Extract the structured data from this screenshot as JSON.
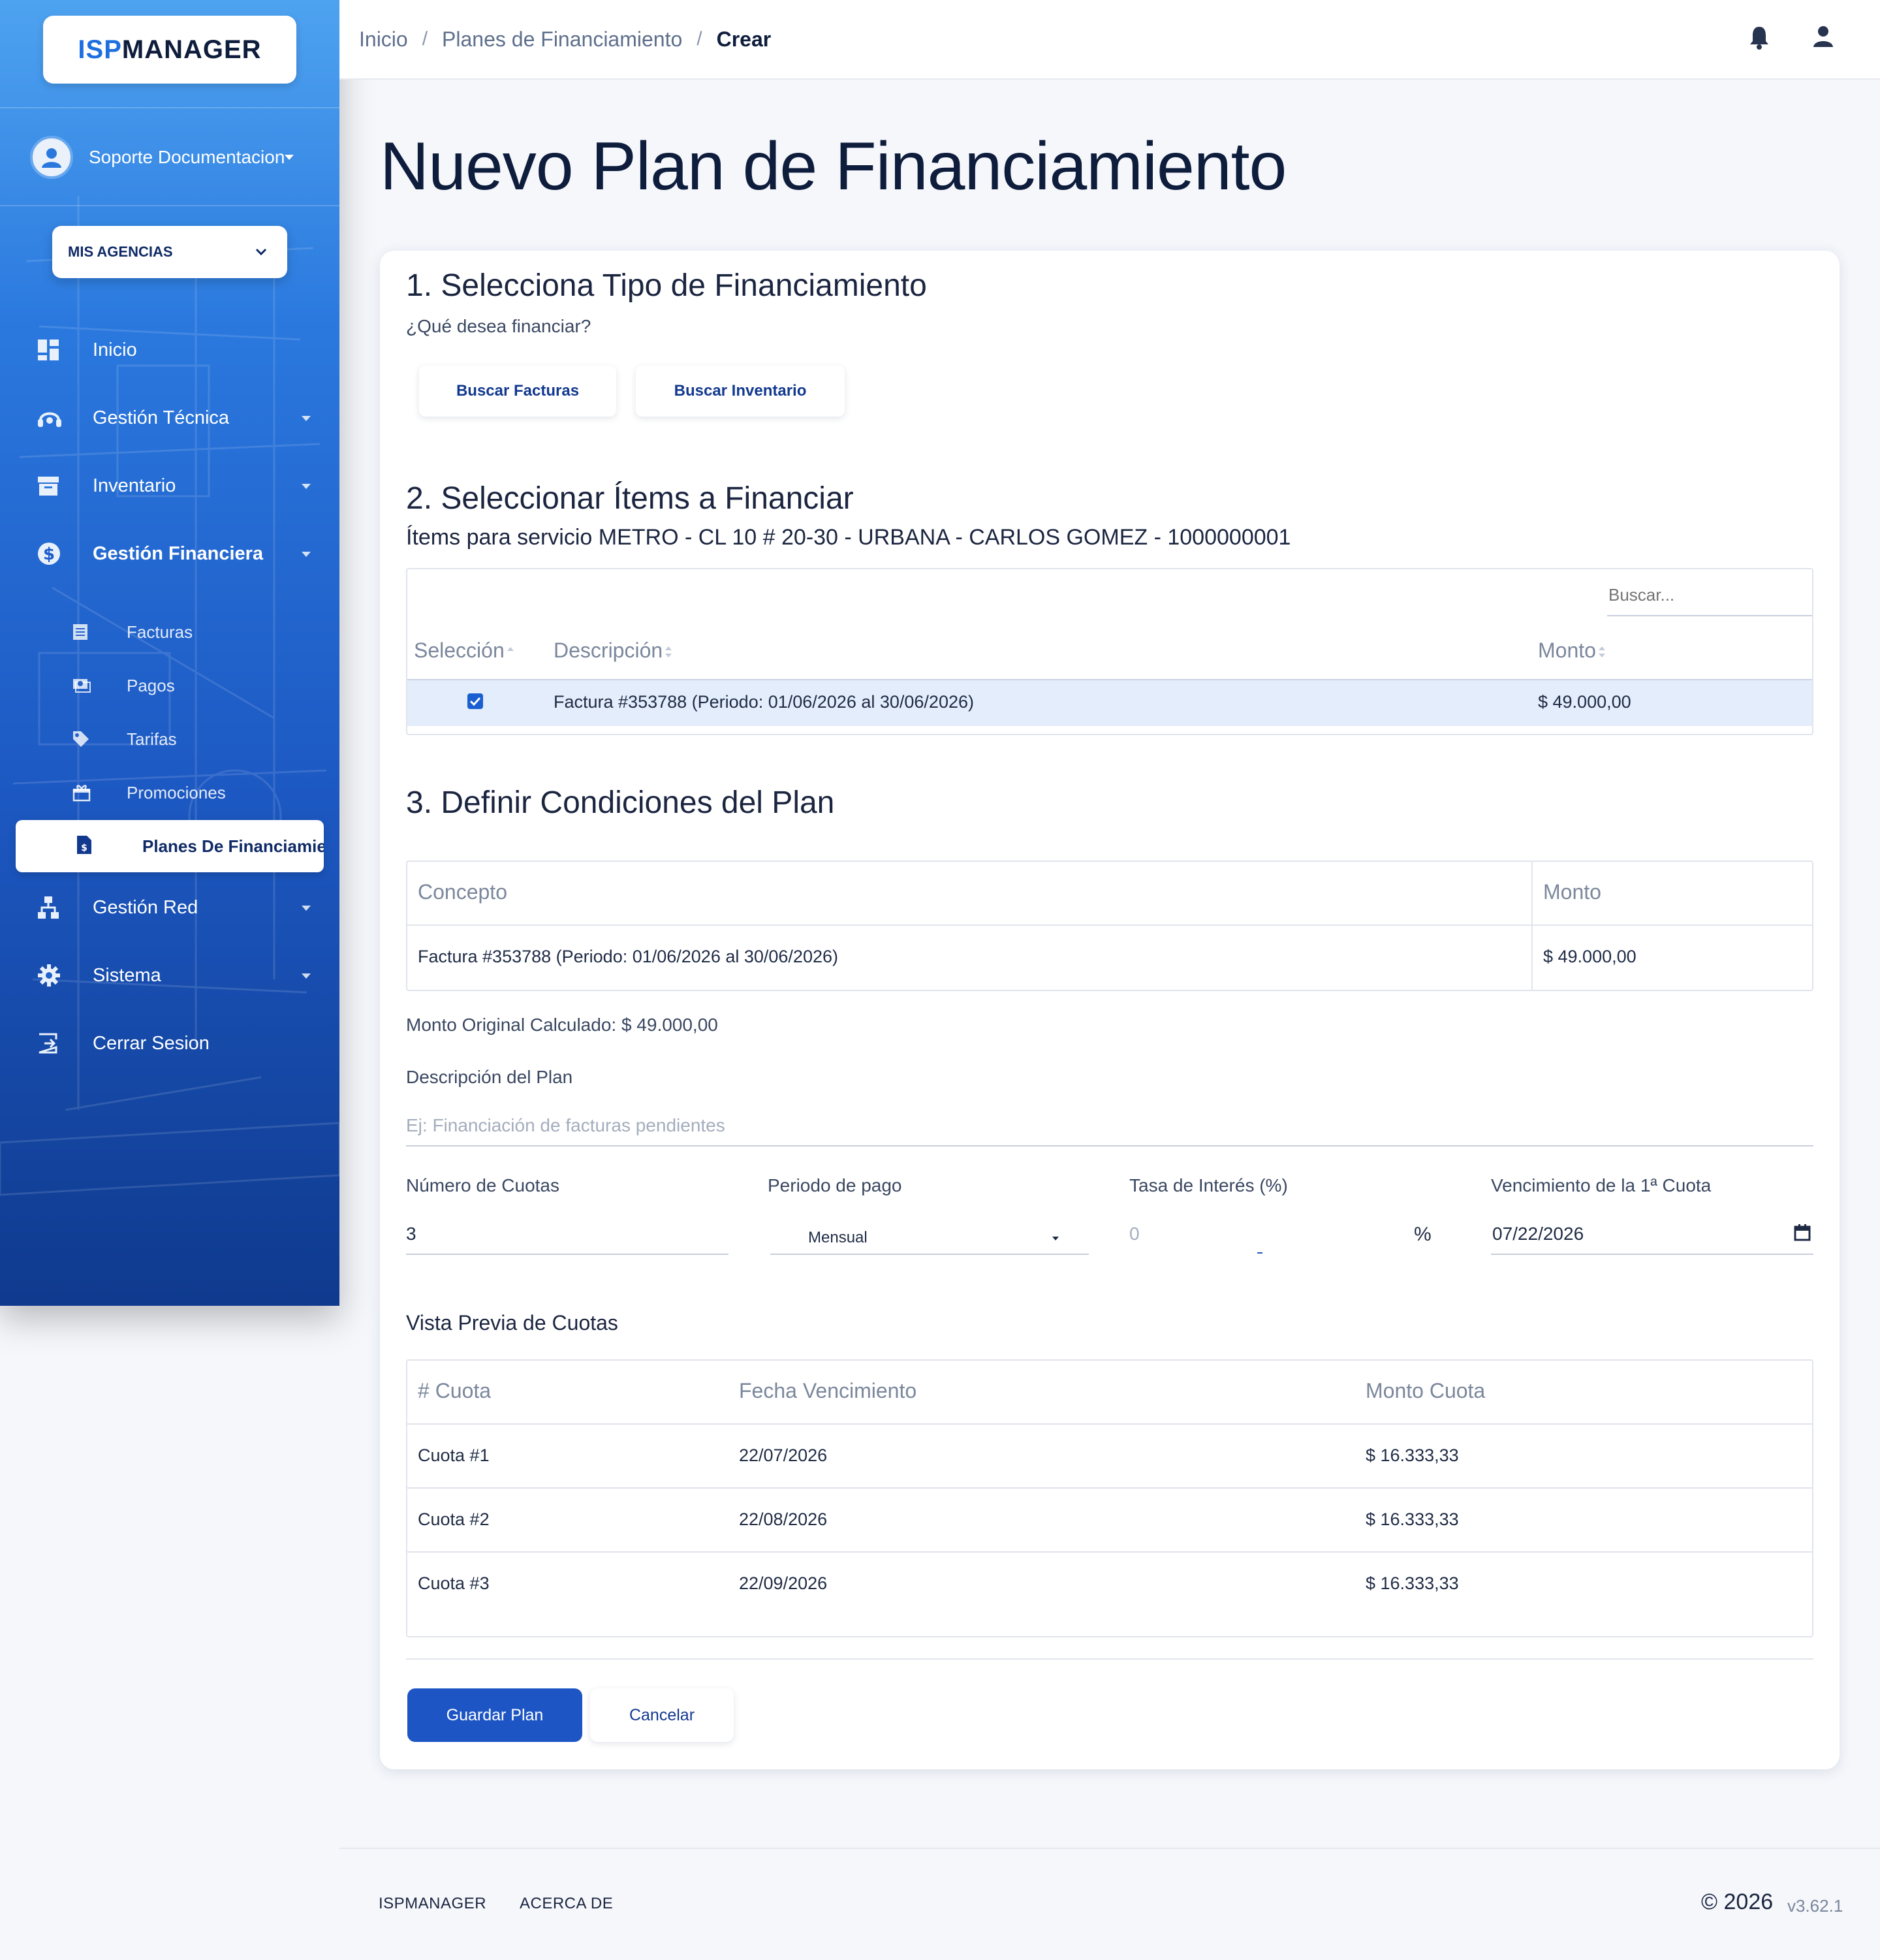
{
  "logo": {
    "isp": "ISP",
    "manager": "MANAGER"
  },
  "user": {
    "name": "Soporte Documentacion"
  },
  "agencies": {
    "label": "MIS AGENCIAS"
  },
  "nav": {
    "inicio": "Inicio",
    "gestion_tecnica": "Gestión Técnica",
    "inventario": "Inventario",
    "gestion_financiera": "Gestión Financiera",
    "sub": {
      "facturas": "Facturas",
      "pagos": "Pagos",
      "tarifas": "Tarifas",
      "promociones": "Promociones",
      "planes": "Planes De Financiamiento"
    },
    "gestion_red": "Gestión Red",
    "sistema": "Sistema",
    "cerrar": "Cerrar Sesion"
  },
  "breadcrumb": {
    "home": "Inicio",
    "section": "Planes de Financiamiento",
    "current": "Crear",
    "sep": "/"
  },
  "page": {
    "title": "Nuevo Plan de Financiamiento"
  },
  "step1": {
    "title": "1. Selecciona Tipo de Financiamiento",
    "subtitle": "¿Qué desea financiar?",
    "btn_facturas": "Buscar Facturas",
    "btn_inventario": "Buscar Inventario"
  },
  "step2": {
    "title": "2. Seleccionar Ítems a Financiar",
    "subtitle": "Ítems para servicio METRO - CL 10 # 20-30 - URBANA - CARLOS GOMEZ - 1000000001",
    "search_placeholder": "Buscar...",
    "columns": {
      "seleccion": "Selección",
      "descripcion": "Descripción",
      "monto": "Monto"
    },
    "row": {
      "descripcion": "Factura #353788 (Periodo: 01/06/2026 al 30/06/2026)",
      "monto": "$ 49.000,00",
      "checked": true
    }
  },
  "step3": {
    "title": "3. Definir Condiciones del Plan",
    "columns": {
      "concepto": "Concepto",
      "monto": "Monto"
    },
    "row": {
      "concepto": "Factura #353788 (Periodo: 01/06/2026 al 30/06/2026)",
      "monto": "$ 49.000,00"
    },
    "monto_original": "Monto Original Calculado: $ 49.000,00",
    "descripcion_label": "Descripción del Plan",
    "descripcion_placeholder": "Ej: Financiación de facturas pendientes",
    "cuotas_label": "Número de Cuotas",
    "cuotas_value": "3",
    "periodo_label": "Periodo de pago",
    "periodo_value": "Mensual",
    "tasa_label": "Tasa de Interés (%)",
    "tasa_placeholder": "0",
    "tasa_suffix": "%",
    "venc_label": "Vencimiento de la 1ª Cuota",
    "venc_value": "07/22/2026"
  },
  "preview": {
    "title": "Vista Previa de Cuotas",
    "columns": {
      "cuota": "# Cuota",
      "fecha": "Fecha Vencimiento",
      "monto": "Monto Cuota"
    },
    "rows": [
      {
        "cuota": "Cuota #1",
        "fecha": "22/07/2026",
        "monto": "$ 16.333,33"
      },
      {
        "cuota": "Cuota #2",
        "fecha": "22/08/2026",
        "monto": "$ 16.333,33"
      },
      {
        "cuota": "Cuota #3",
        "fecha": "22/09/2026",
        "monto": "$ 16.333,33"
      }
    ]
  },
  "actions": {
    "save": "Guardar Plan",
    "cancel": "Cancelar"
  },
  "footer": {
    "brand": "ISPMANAGER",
    "about": "ACERCA DE",
    "copyright": "© 2026",
    "version": "v3.62.1"
  },
  "colors": {
    "primary": "#1e55c4",
    "sidebar_top": "#4ea3f0",
    "sidebar_bottom": "#0f3a8e",
    "text_dark": "#0f1d3d"
  }
}
